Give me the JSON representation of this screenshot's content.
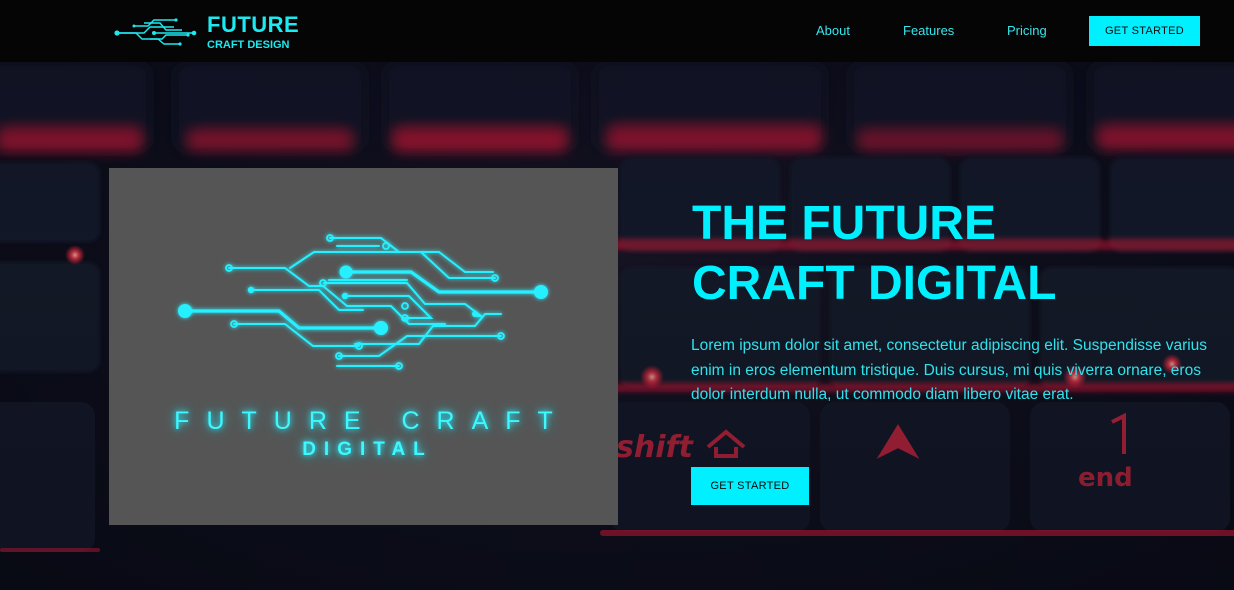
{
  "brand": {
    "title": "FUTURE",
    "subtitle": "CRAFT DESIGN",
    "logo_icon": "circuit-icon"
  },
  "nav": {
    "links": [
      {
        "label": "About"
      },
      {
        "label": "Features"
      },
      {
        "label": "Pricing"
      }
    ],
    "cta_label": "GET STARTED"
  },
  "hero": {
    "headline_line1": "THE FUTURE",
    "headline_line2": "CRAFT DIGITAL",
    "body": "Lorem ipsum dolor sit amet, consectetur adipiscing elit. Suspendisse varius enim in eros elementum tristique. Duis cursus, mi quis viverra ornare, eros dolor interdum nulla, ut commodo diam libero vitae erat.",
    "cta_label": "GET STARTED"
  },
  "graphic": {
    "line1": "FUTURE CRAFT",
    "line2": "DIGITAL",
    "icon": "circuit-icon"
  },
  "colors": {
    "accent": "#00f0ff",
    "header_bg": "#050505",
    "card_bg": "#555555",
    "keyboard_glow": "#ff1a3c"
  }
}
